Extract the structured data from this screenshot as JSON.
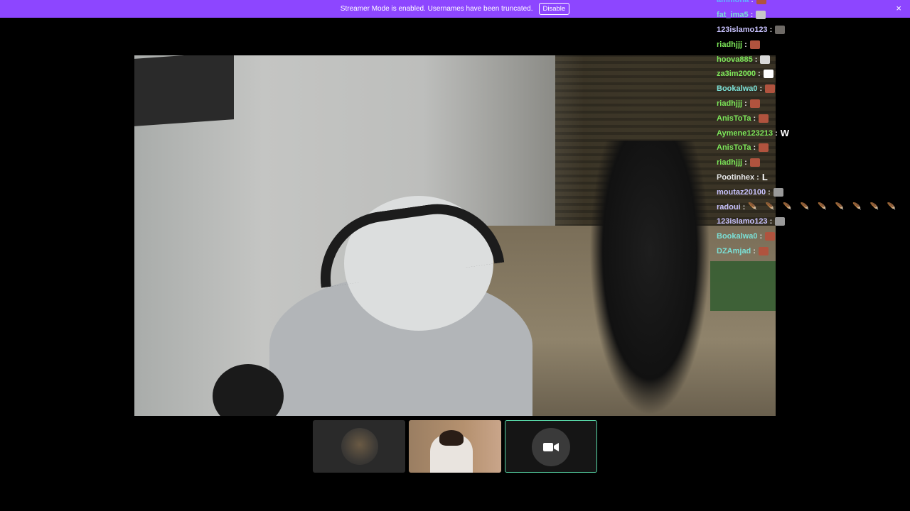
{
  "banner": {
    "message": "Streamer Mode is enabled. Usernames have been truncated.",
    "button_label": "Disable",
    "close_icon": "×",
    "background": "#8d46ff"
  },
  "chat": {
    "messages": [
      {
        "user": "ammona",
        "color": "#5fb4ff",
        "emote": "emote-red-face",
        "emote_color": "#b0533e"
      },
      {
        "user": "fat_ima5",
        "color": "#7be0d6",
        "emote": "emote-cat",
        "emote_color": "#c8c8c8"
      },
      {
        "user": "123islamo123",
        "color": "#c9c3ff",
        "emote": "emote-gray-face",
        "emote_color": "#6e6a66"
      },
      {
        "user": "riadhjjj",
        "color": "#7ee85a",
        "emote": "emote-red-face",
        "emote_color": "#b0533e"
      },
      {
        "user": "hoova885",
        "color": "#7ee85a",
        "emote": "emote-white-creature",
        "emote_color": "#d8d8d8"
      },
      {
        "user": "za3im2000",
        "color": "#7ee85a",
        "emote": "emote-mute-speaker",
        "emote_color": "#ffffff"
      },
      {
        "user": "Bookalwa0",
        "color": "#7be0d6",
        "emote": "emote-red-face",
        "emote_color": "#b0533e"
      },
      {
        "user": "riadhjjj",
        "color": "#7ee85a",
        "emote": "emote-red-face",
        "emote_color": "#b0533e"
      },
      {
        "user": "AnisToTa",
        "color": "#7ee85a",
        "emote": "emote-red-face",
        "emote_color": "#b0533e"
      },
      {
        "user": "Aymene123213",
        "color": "#7ee85a",
        "emote": "emote-w",
        "emote_color": "#ffffff",
        "emote_text": "W"
      },
      {
        "user": "AnisToTa",
        "color": "#7ee85a",
        "emote": "emote-red-face",
        "emote_color": "#b0533e"
      },
      {
        "user": "riadhjjj",
        "color": "#7ee85a",
        "emote": "emote-red-face",
        "emote_color": "#b0533e"
      },
      {
        "user": "Pootinhex",
        "color": "#e8e8e8",
        "emote": "emote-l",
        "emote_color": "#ffffff",
        "emote_text": "L"
      },
      {
        "user": "moutaz20100",
        "color": "#c9c3ff",
        "emote": "emote-frame",
        "emote_color": "#9a9a9a"
      },
      {
        "user": "radoui",
        "color": "#c9c3ff",
        "emote": "emote-drops",
        "emote_color": "#ffffff",
        "emote_text": "🪶🪶🪶🪶🪶🪶🪶🪶🪶"
      },
      {
        "user": "123islamo123",
        "color": "#c9c3ff",
        "emote": "emote-frame",
        "emote_color": "#9a9a9a"
      },
      {
        "user": "Bookalwa0",
        "color": "#7be0d6",
        "emote": "emote-red-face",
        "emote_color": "#b0533e"
      },
      {
        "user": "DZAmjad",
        "color": "#7be0d6",
        "emote": "emote-red-face",
        "emote_color": "#b0533e"
      }
    ]
  },
  "tiles": [
    {
      "kind": "avatar",
      "label": "participant-avatar"
    },
    {
      "kind": "webcam",
      "label": "participant-webcam"
    },
    {
      "kind": "camera-off",
      "label": "camera-button",
      "accent": "#57d6a6"
    }
  ]
}
